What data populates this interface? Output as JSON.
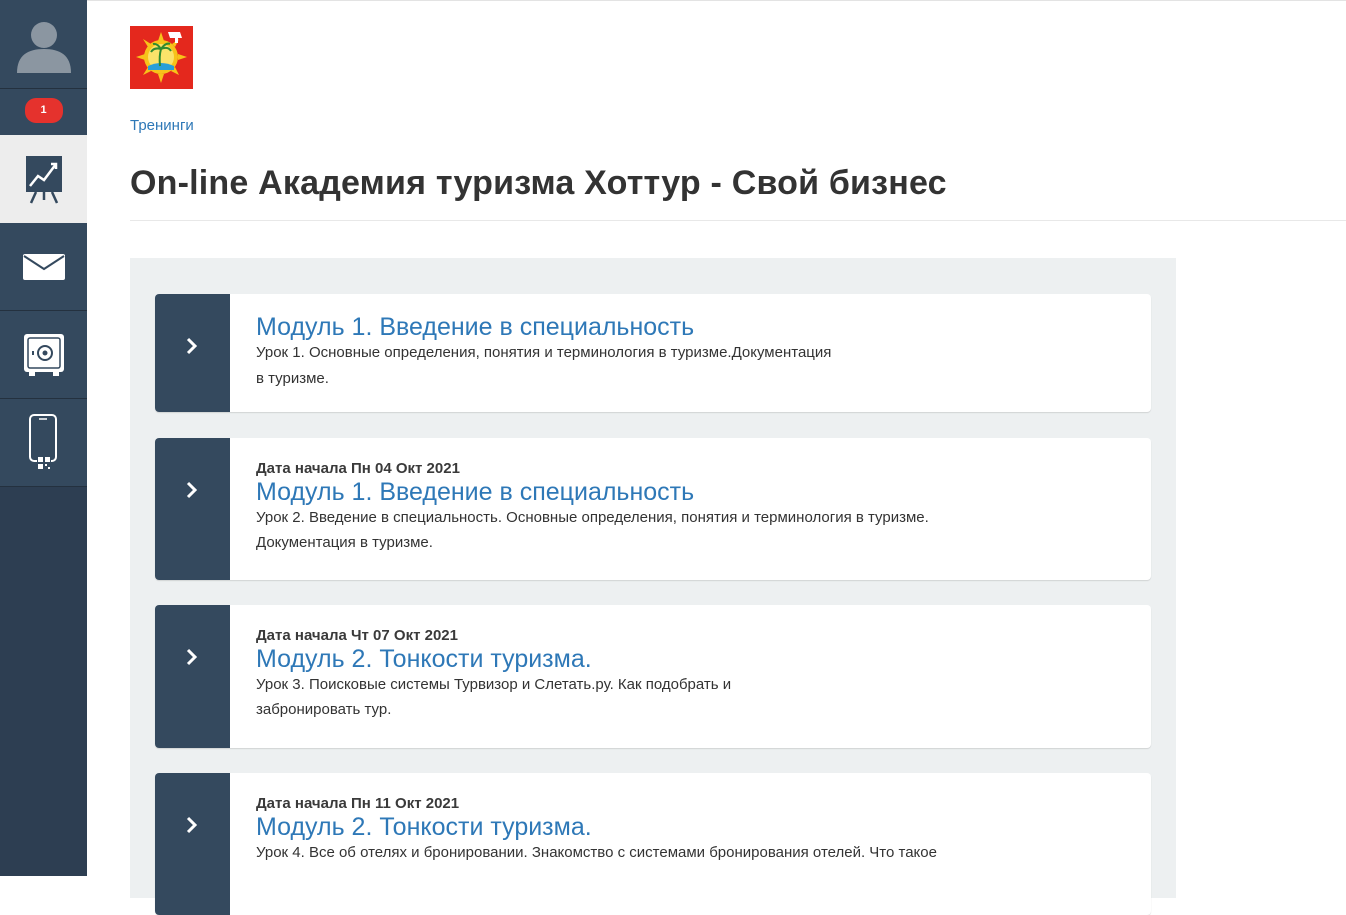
{
  "sidebar": {
    "badge_count": "1",
    "items": [
      {
        "icon": "trainings-chart-icon",
        "active": true
      },
      {
        "icon": "mail-icon",
        "active": false
      },
      {
        "icon": "safe-icon",
        "active": false
      },
      {
        "icon": "mobile-qr-icon",
        "active": false
      }
    ]
  },
  "header": {
    "breadcrumb": "Тренинги",
    "title": "On-line Академия туризма Хоттур - Свой бизнес"
  },
  "lessons": [
    {
      "date": "",
      "module": "Модуль 1. Введение в специальность",
      "line1": "Урок 1. Основные определения, понятия и терминология в туризме.Документация",
      "line2": "в туризме."
    },
    {
      "date": "Дата начала Пн 04 Окт 2021",
      "module": "Модуль 1. Введение в специальность",
      "line1": "Урок 2. Введение в специальность. Основные определения, понятия и терминология в туризме.",
      "line2": "Документация в туризме."
    },
    {
      "date": "Дата начала Чт 07 Окт 2021",
      "module": "Модуль 2. Тонкости туризма.",
      "line1": "Урок 3. Поисковые системы Турвизор и Слетать.ру. Как подобрать и",
      "line2": "забронировать тур."
    },
    {
      "date": "Дата начала Пн 11 Окт 2021",
      "module": "Модуль 2. Тонкости туризма.",
      "line1": "Урок 4. Все об отелях и бронировании. Знакомство с системами бронирования отелей. Что такое",
      "line2": ""
    }
  ],
  "colors": {
    "sidebar_bg": "#2d3e52",
    "accent": "#2e78b7",
    "badge": "#e5322d"
  }
}
